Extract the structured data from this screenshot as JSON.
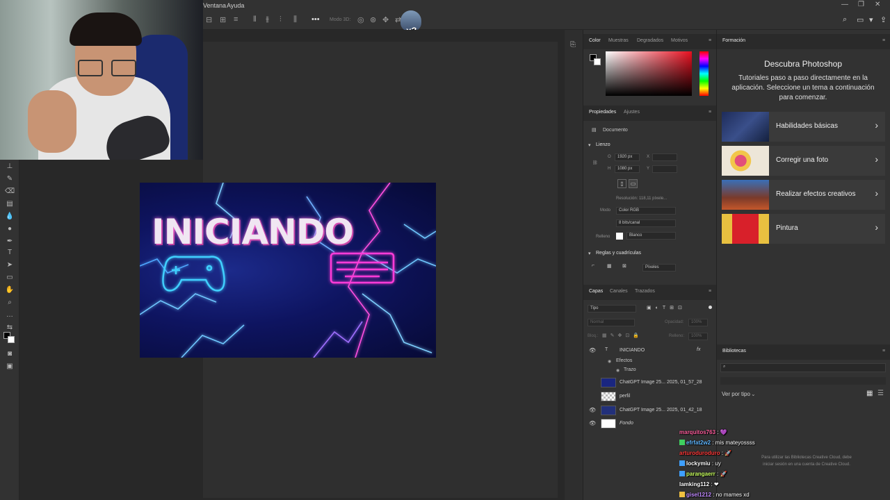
{
  "menubar": {
    "items": [
      "Ventana",
      "Ayuda"
    ]
  },
  "optionsbar": {
    "mode_label": "Modo 3D:"
  },
  "overlay_counter": "x3",
  "document": {
    "title_text": "INICIANDO"
  },
  "color_panel": {
    "tabs": [
      "Color",
      "Muestras",
      "Degradados",
      "Motivos"
    ]
  },
  "properties_panel": {
    "tabs": [
      "Propiedades",
      "Ajustes"
    ],
    "doc_label": "Documento",
    "canvas_section": "Lienzo",
    "width_label": "O",
    "width_value": "1920 px",
    "height_label": "H",
    "height_value": "1080 px",
    "x_label": "X",
    "y_label": "Y",
    "resolution": "Resolución: 118,11 píxele...",
    "mode_label": "Modo",
    "mode_value": "Color RGB",
    "bits_value": "8 bits/canal",
    "fill_label": "Relleno",
    "fill_value": "Blanco",
    "rulers_section": "Reglas y cuadrículas",
    "units_value": "Píxeles"
  },
  "layers_panel": {
    "tabs": [
      "Capas",
      "Canales",
      "Trazados"
    ],
    "filter": "Tipo",
    "blend_mode": "Normal",
    "opacity_label": "Opacidad:",
    "opacity_value": "100%",
    "lock_label": "Bloq.:",
    "fill_label": "Relleno:",
    "fill_value": "100%",
    "layers": [
      {
        "name": "INICIANDO",
        "visible": true,
        "fx": "fx"
      },
      {
        "name": "Efectos",
        "visible": true
      },
      {
        "name": "Trazo",
        "visible": true
      },
      {
        "name": "ChatGPT Image 25... 2025, 01_57_28",
        "visible": false
      },
      {
        "name": "perfil",
        "visible": false
      },
      {
        "name": "ChatGPT Image 25... 2025, 01_42_18",
        "visible": true
      },
      {
        "name": "Fondo",
        "visible": true
      }
    ]
  },
  "learn_panel": {
    "tab": "Formación",
    "heading": "Descubra Photoshop",
    "description": "Tutoriales paso a paso directamente en la aplicación. Seleccione un tema a continuación para comenzar.",
    "cards": [
      "Habilidades básicas",
      "Corregir una foto",
      "Realizar efectos creativos",
      "Pintura"
    ]
  },
  "libraries_panel": {
    "tab": "Bibliotecas",
    "view_by": "Ver por tipo",
    "empty_message": "Para utilizar las Bibliotecas Creative Cloud, debe iniciar sesión en una cuenta de Creative Cloud."
  },
  "chat": [
    {
      "user": "marquitos763",
      "msg": "",
      "color": "#ff5f9e",
      "emote": true
    },
    {
      "user": "efrfat2w2",
      "msg": "mis mateyossss",
      "color": "#5fb6ff",
      "emote": false
    },
    {
      "user": "arturoduroduro",
      "msg": "",
      "color": "#ff3b3b",
      "emote": true
    },
    {
      "user": "lockymiu",
      "msg": "uy",
      "color": "#ffffff",
      "emote": false
    },
    {
      "user": "parangaerr",
      "msg": "",
      "color": "#c8ff5f",
      "emote": true
    },
    {
      "user": "lamking112",
      "msg": "",
      "color": "#ffffff",
      "emote": true
    },
    {
      "user": "gisel1212",
      "msg": "no mames xd",
      "color": "#c08aff",
      "emote": false
    }
  ]
}
